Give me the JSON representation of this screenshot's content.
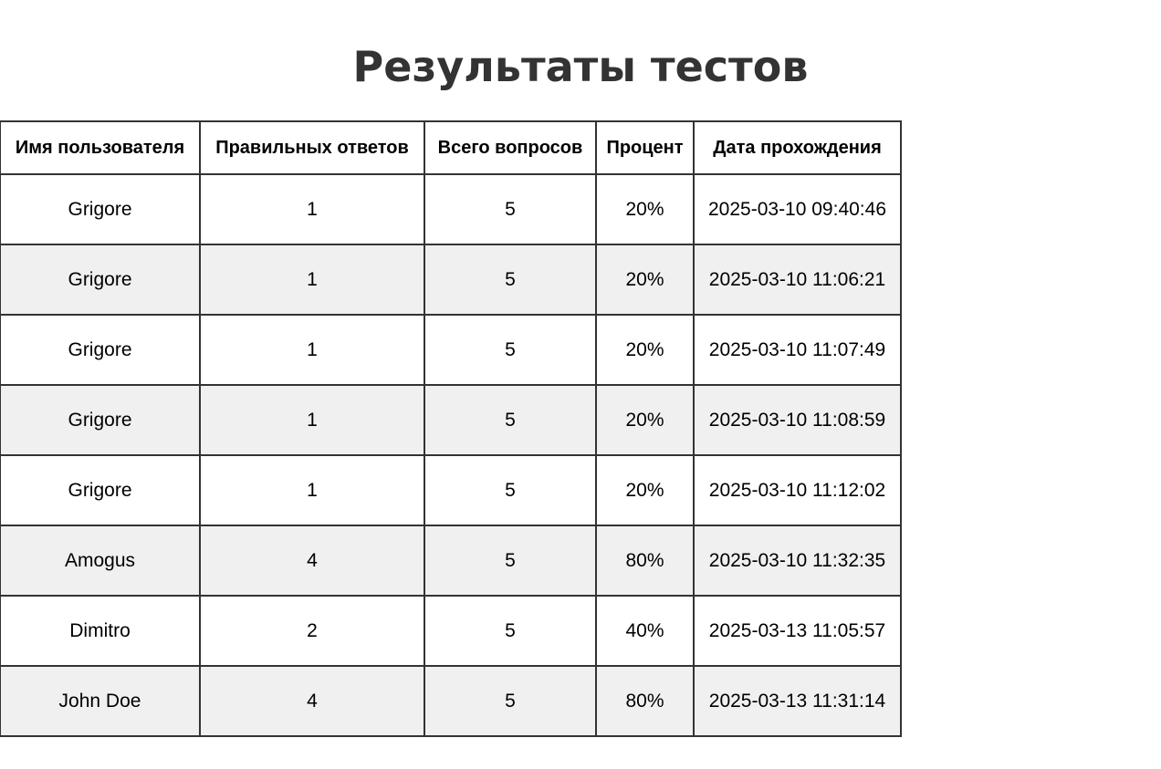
{
  "page": {
    "title": "Результаты тестов"
  },
  "table": {
    "headers": {
      "user": "Имя пользователя",
      "correct": "Правильных ответов",
      "total": "Всего вопросов",
      "percent": "Процент",
      "date": "Дата прохождения"
    },
    "rows": [
      {
        "user": "Grigore",
        "correct": "1",
        "total": "5",
        "percent": "20%",
        "date": "2025-03-10 09:40:46"
      },
      {
        "user": "Grigore",
        "correct": "1",
        "total": "5",
        "percent": "20%",
        "date": "2025-03-10 11:06:21"
      },
      {
        "user": "Grigore",
        "correct": "1",
        "total": "5",
        "percent": "20%",
        "date": "2025-03-10 11:07:49"
      },
      {
        "user": "Grigore",
        "correct": "1",
        "total": "5",
        "percent": "20%",
        "date": "2025-03-10 11:08:59"
      },
      {
        "user": "Grigore",
        "correct": "1",
        "total": "5",
        "percent": "20%",
        "date": "2025-03-10 11:12:02"
      },
      {
        "user": "Amogus",
        "correct": "4",
        "total": "5",
        "percent": "80%",
        "date": "2025-03-10 11:32:35"
      },
      {
        "user": "Dimitro",
        "correct": "2",
        "total": "5",
        "percent": "40%",
        "date": "2025-03-13 11:05:57"
      },
      {
        "user": "John Doe",
        "correct": "4",
        "total": "5",
        "percent": "80%",
        "date": "2025-03-13 11:31:14"
      }
    ]
  },
  "colors": {
    "title": "#333333",
    "border": "#333333",
    "row_alt": "#f0f0f0",
    "row_base": "#ffffff"
  }
}
